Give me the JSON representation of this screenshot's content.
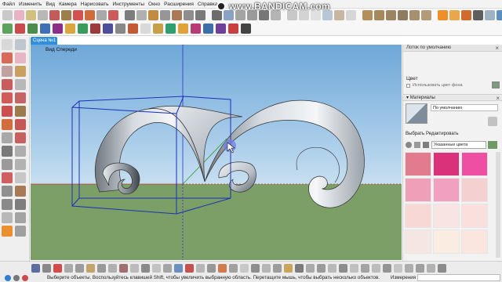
{
  "menu": [
    "Файл",
    "Изменить",
    "Вид",
    "Камера",
    "Нарисовать",
    "Инструменты",
    "Окно",
    "Расширения",
    "Справка"
  ],
  "watermark": "www.BANDICAM.com",
  "scene_tab": "Сцена №1",
  "viewport": {
    "view_label": "Вид Спереди"
  },
  "panel": {
    "tray_title": "Лоток по умолчанию",
    "color_label": "Цвет",
    "use_color_label": "Использовать цвет фона",
    "materials_title": "Материалы",
    "material_name": "По умолчанию",
    "tab_select": "Выбрать",
    "tab_edit": "Редактировать",
    "dropdown": "Указанные цвета",
    "swatches": [
      "#e37b8f",
      "#d9327a",
      "#ef4fa2",
      "#f09fb8",
      "#f2a0c0",
      "#f4d0d0",
      "#f8d8d5",
      "#f8e4e2",
      "#fae0dd",
      "#f6e6e2",
      "#fbece2",
      "#fae6df"
    ],
    "close": "×"
  },
  "status": {
    "text": "Выберите объекты. Воспользуйтесь клавишей Shift, чтобы увеличить выбранную область. Перетащите мышь, чтобы выбрать несколько объектов.",
    "measure_label": "Измерения"
  },
  "colors": {
    "sky_top": "#6ea7d8",
    "ground": "#7b9f66",
    "selection": "#1d2fb8",
    "accent": "#2f8fdc"
  }
}
